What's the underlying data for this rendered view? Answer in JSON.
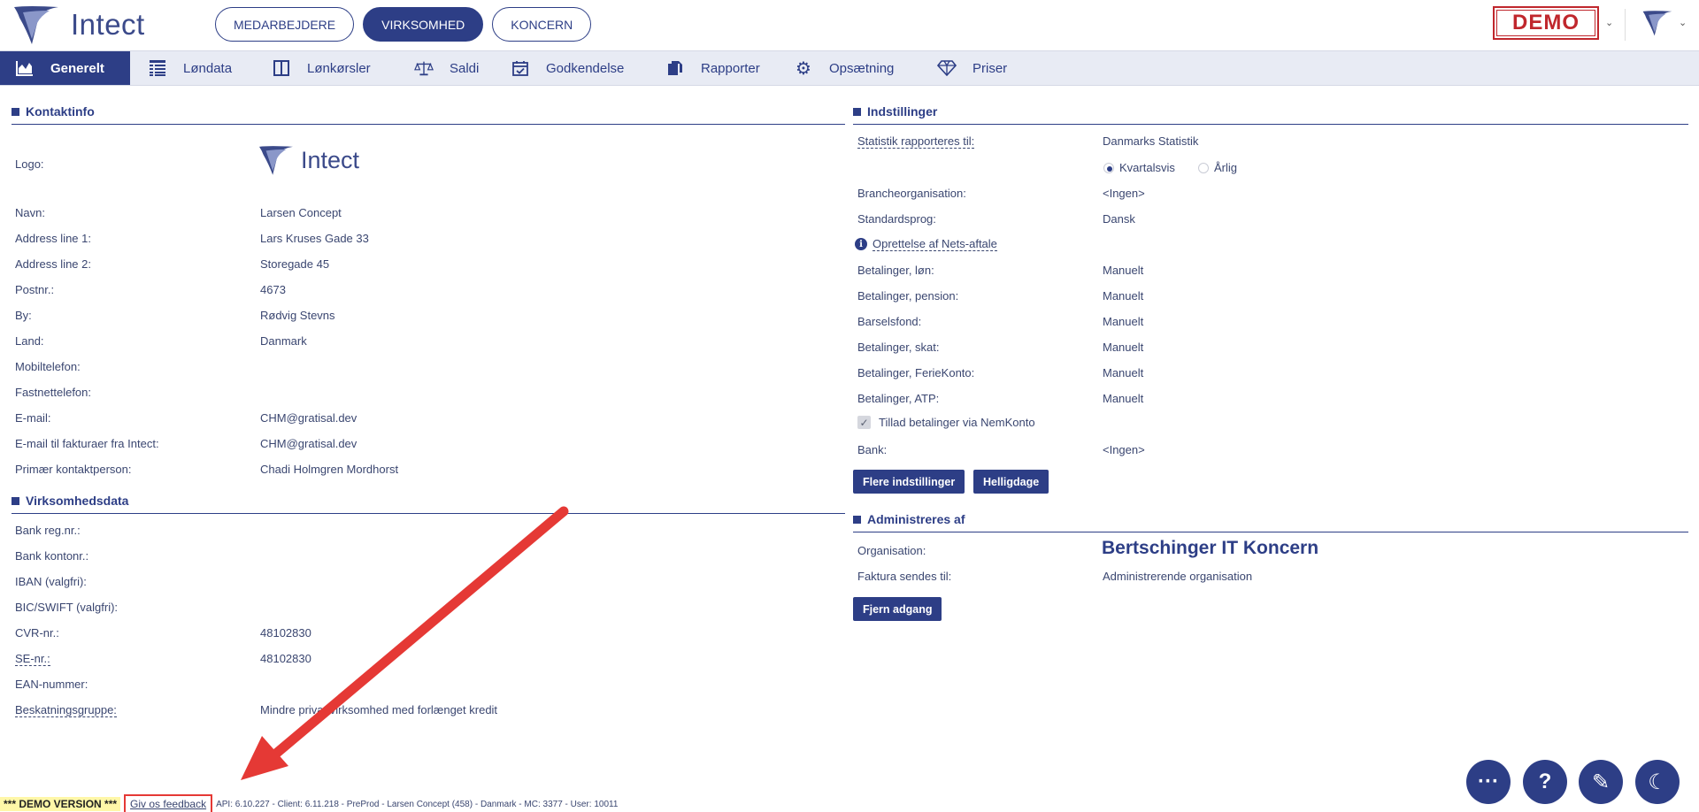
{
  "header": {
    "logo_text": "Intect",
    "tabs": [
      {
        "label": "MEDARBEJDERE",
        "active": false
      },
      {
        "label": "VIRKSOMHED",
        "active": true
      },
      {
        "label": "KONCERN",
        "active": false
      }
    ],
    "demo_label": "DEMO"
  },
  "nav": {
    "items": [
      {
        "label": "Generelt",
        "icon": "chart-icon",
        "active": true
      },
      {
        "label": "Løndata",
        "icon": "grid-icon"
      },
      {
        "label": "Lønkørsler",
        "icon": "columns-icon"
      },
      {
        "label": "Saldi",
        "icon": "scale-icon"
      },
      {
        "label": "Godkendelse",
        "icon": "calendar-check-icon"
      },
      {
        "label": "Rapporter",
        "icon": "documents-icon"
      },
      {
        "label": "Opsætning",
        "icon": "gear-icon"
      },
      {
        "label": "Priser",
        "icon": "diamond-icon"
      }
    ]
  },
  "kontaktinfo": {
    "title": "Kontaktinfo",
    "logo_label": "Logo:",
    "logo_text": "Intect",
    "rows": [
      {
        "label": "Navn:",
        "value": "Larsen Concept"
      },
      {
        "label": "Address line 1:",
        "value": "Lars Kruses Gade 33"
      },
      {
        "label": "Address line 2:",
        "value": "Storegade 45"
      },
      {
        "label": "Postnr.:",
        "value": "4673"
      },
      {
        "label": "By:",
        "value": "Rødvig Stevns"
      },
      {
        "label": "Land:",
        "value": "Danmark"
      },
      {
        "label": "Mobiltelefon:",
        "value": ""
      },
      {
        "label": "Fastnettelefon:",
        "value": ""
      },
      {
        "label": "E-mail:",
        "value": "CHM@gratisal.dev"
      },
      {
        "label": "E-mail til fakturaer fra Intect:",
        "value": "CHM@gratisal.dev"
      },
      {
        "label": "Primær kontaktperson:",
        "value": "Chadi Holmgren Mordhorst"
      }
    ]
  },
  "virksomhedsdata": {
    "title": "Virksomhedsdata",
    "rows": [
      {
        "label": "Bank reg.nr.:",
        "value": ""
      },
      {
        "label": "Bank kontonr.:",
        "value": ""
      },
      {
        "label": "IBAN (valgfri):",
        "value": ""
      },
      {
        "label": "BIC/SWIFT (valgfri):",
        "value": ""
      },
      {
        "label": "CVR-nr.:",
        "value": "48102830"
      },
      {
        "label": "SE-nr.:",
        "value": "48102830"
      },
      {
        "label": "EAN-nummer:",
        "value": ""
      },
      {
        "label": "Beskatningsgruppe:",
        "value": "Mindre privat virksomhed med forlænget kredit"
      }
    ]
  },
  "indstillinger": {
    "title": "Indstillinger",
    "statistik_label": "Statistik rapporteres til:",
    "statistik_value": "Danmarks Statistik",
    "radio_kvartal": "Kvartalsvis",
    "radio_aarlig": "Årlig",
    "branche_label": "Brancheorganisation:",
    "branche_value": "<Ingen>",
    "sprog_label": "Standardsprog:",
    "sprog_value": "Dansk",
    "nets_link": "Oprettelse af Nets-aftale",
    "payments": [
      {
        "label": "Betalinger, løn:",
        "value": "Manuelt"
      },
      {
        "label": "Betalinger, pension:",
        "value": "Manuelt"
      },
      {
        "label": "Barselsfond:",
        "value": "Manuelt"
      },
      {
        "label": "Betalinger, skat:",
        "value": "Manuelt"
      },
      {
        "label": "Betalinger, FerieKonto:",
        "value": "Manuelt"
      },
      {
        "label": "Betalinger, ATP:",
        "value": "Manuelt"
      }
    ],
    "nemkonto_label": "Tillad betalinger via NemKonto",
    "bank_label": "Bank:",
    "bank_value": "<Ingen>",
    "btn_more": "Flere indstillinger",
    "btn_holidays": "Helligdage"
  },
  "administreres": {
    "title": "Administreres af",
    "org_label": "Organisation:",
    "org_value": "Bertschinger IT Koncern",
    "faktura_label": "Faktura sendes til:",
    "faktura_value": "Administrerende organisation",
    "btn_remove": "Fjern adgang"
  },
  "footer": {
    "demo_version": "*** DEMO VERSION ***",
    "feedback": "Giv os feedback",
    "info": "API: 6.10.227 - Client: 6.11.218 - PreProd  - Larsen Concept (458) - Danmark - MC: 3377  - User: 10011"
  },
  "fabs": [
    {
      "icon": "more-icon",
      "glyph": "···"
    },
    {
      "icon": "help-icon",
      "glyph": "?"
    },
    {
      "icon": "pencil-icon",
      "glyph": "✎"
    },
    {
      "icon": "moon-icon",
      "glyph": "☾"
    }
  ],
  "colors": {
    "brand": "#2d3e86",
    "demo_red": "#c0272d",
    "annotation_red": "#e53935"
  }
}
